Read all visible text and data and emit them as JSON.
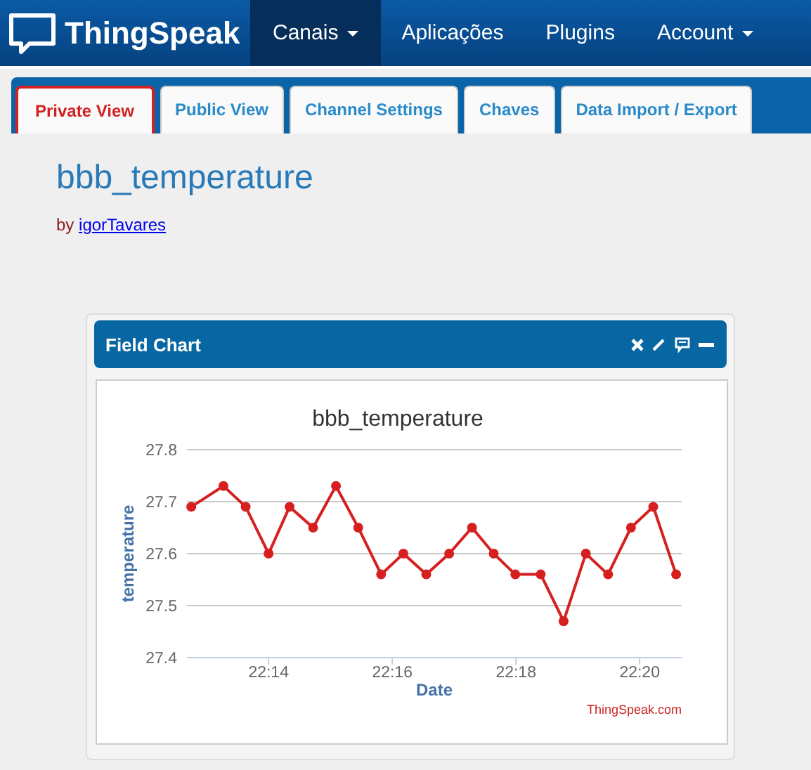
{
  "navbar": {
    "brand": "ThingSpeak",
    "items": [
      {
        "label": "Canais",
        "selected": true,
        "dropdown": true
      },
      {
        "label": "Aplicações",
        "selected": false,
        "dropdown": false
      },
      {
        "label": "Plugins",
        "selected": false,
        "dropdown": false
      },
      {
        "label": "Account",
        "selected": false,
        "dropdown": true
      }
    ]
  },
  "tabs": [
    {
      "label": "Private View",
      "selected": true
    },
    {
      "label": "Public View",
      "selected": false
    },
    {
      "label": "Channel Settings",
      "selected": false
    },
    {
      "label": "Chaves",
      "selected": false
    },
    {
      "label": "Data Import / Export",
      "selected": false
    }
  ],
  "channel": {
    "title": "bbb_temperature",
    "by": "by",
    "author": "igorTavares"
  },
  "widget": {
    "title": "Field Chart",
    "credit": "ThingSpeak.com",
    "chart_data": {
      "type": "line",
      "title": "bbb_temperature",
      "xlabel": "Date",
      "ylabel": "temperature",
      "x": [
        1332.75,
        1333.27,
        1333.63,
        1334.0,
        1334.34,
        1334.72,
        1335.09,
        1335.45,
        1335.82,
        1336.18,
        1336.55,
        1336.92,
        1337.29,
        1337.64,
        1337.99,
        1338.4,
        1338.77,
        1339.13,
        1339.49,
        1339.86,
        1340.22,
        1340.59
      ],
      "grid": true,
      "series": [
        {
          "marker": true,
          "color": "#d62020",
          "values": [
            27.69,
            27.73,
            27.69,
            27.6,
            27.69,
            27.65,
            27.73,
            27.65,
            27.56,
            27.6,
            27.56,
            27.6,
            27.65,
            27.6,
            27.56,
            27.56,
            27.47,
            27.6,
            27.56,
            27.65,
            27.69,
            27.56
          ]
        }
      ],
      "xlim": [
        1332.68,
        1340.68
      ],
      "ylim": [
        27.4,
        27.8
      ],
      "xticks": [
        {
          "value": 1334,
          "label": "22:14"
        },
        {
          "value": 1336,
          "label": "22:16"
        },
        {
          "value": 1338,
          "label": "22:18"
        },
        {
          "value": 1340,
          "label": "22:20"
        }
      ],
      "yticks": [
        {
          "value": 27.4,
          "label": "27.4"
        },
        {
          "value": 27.5,
          "label": "27.5"
        },
        {
          "value": 27.6,
          "label": "27.6"
        },
        {
          "value": 27.7,
          "label": "27.7"
        },
        {
          "value": 27.8,
          "label": "27.8"
        }
      ]
    }
  }
}
